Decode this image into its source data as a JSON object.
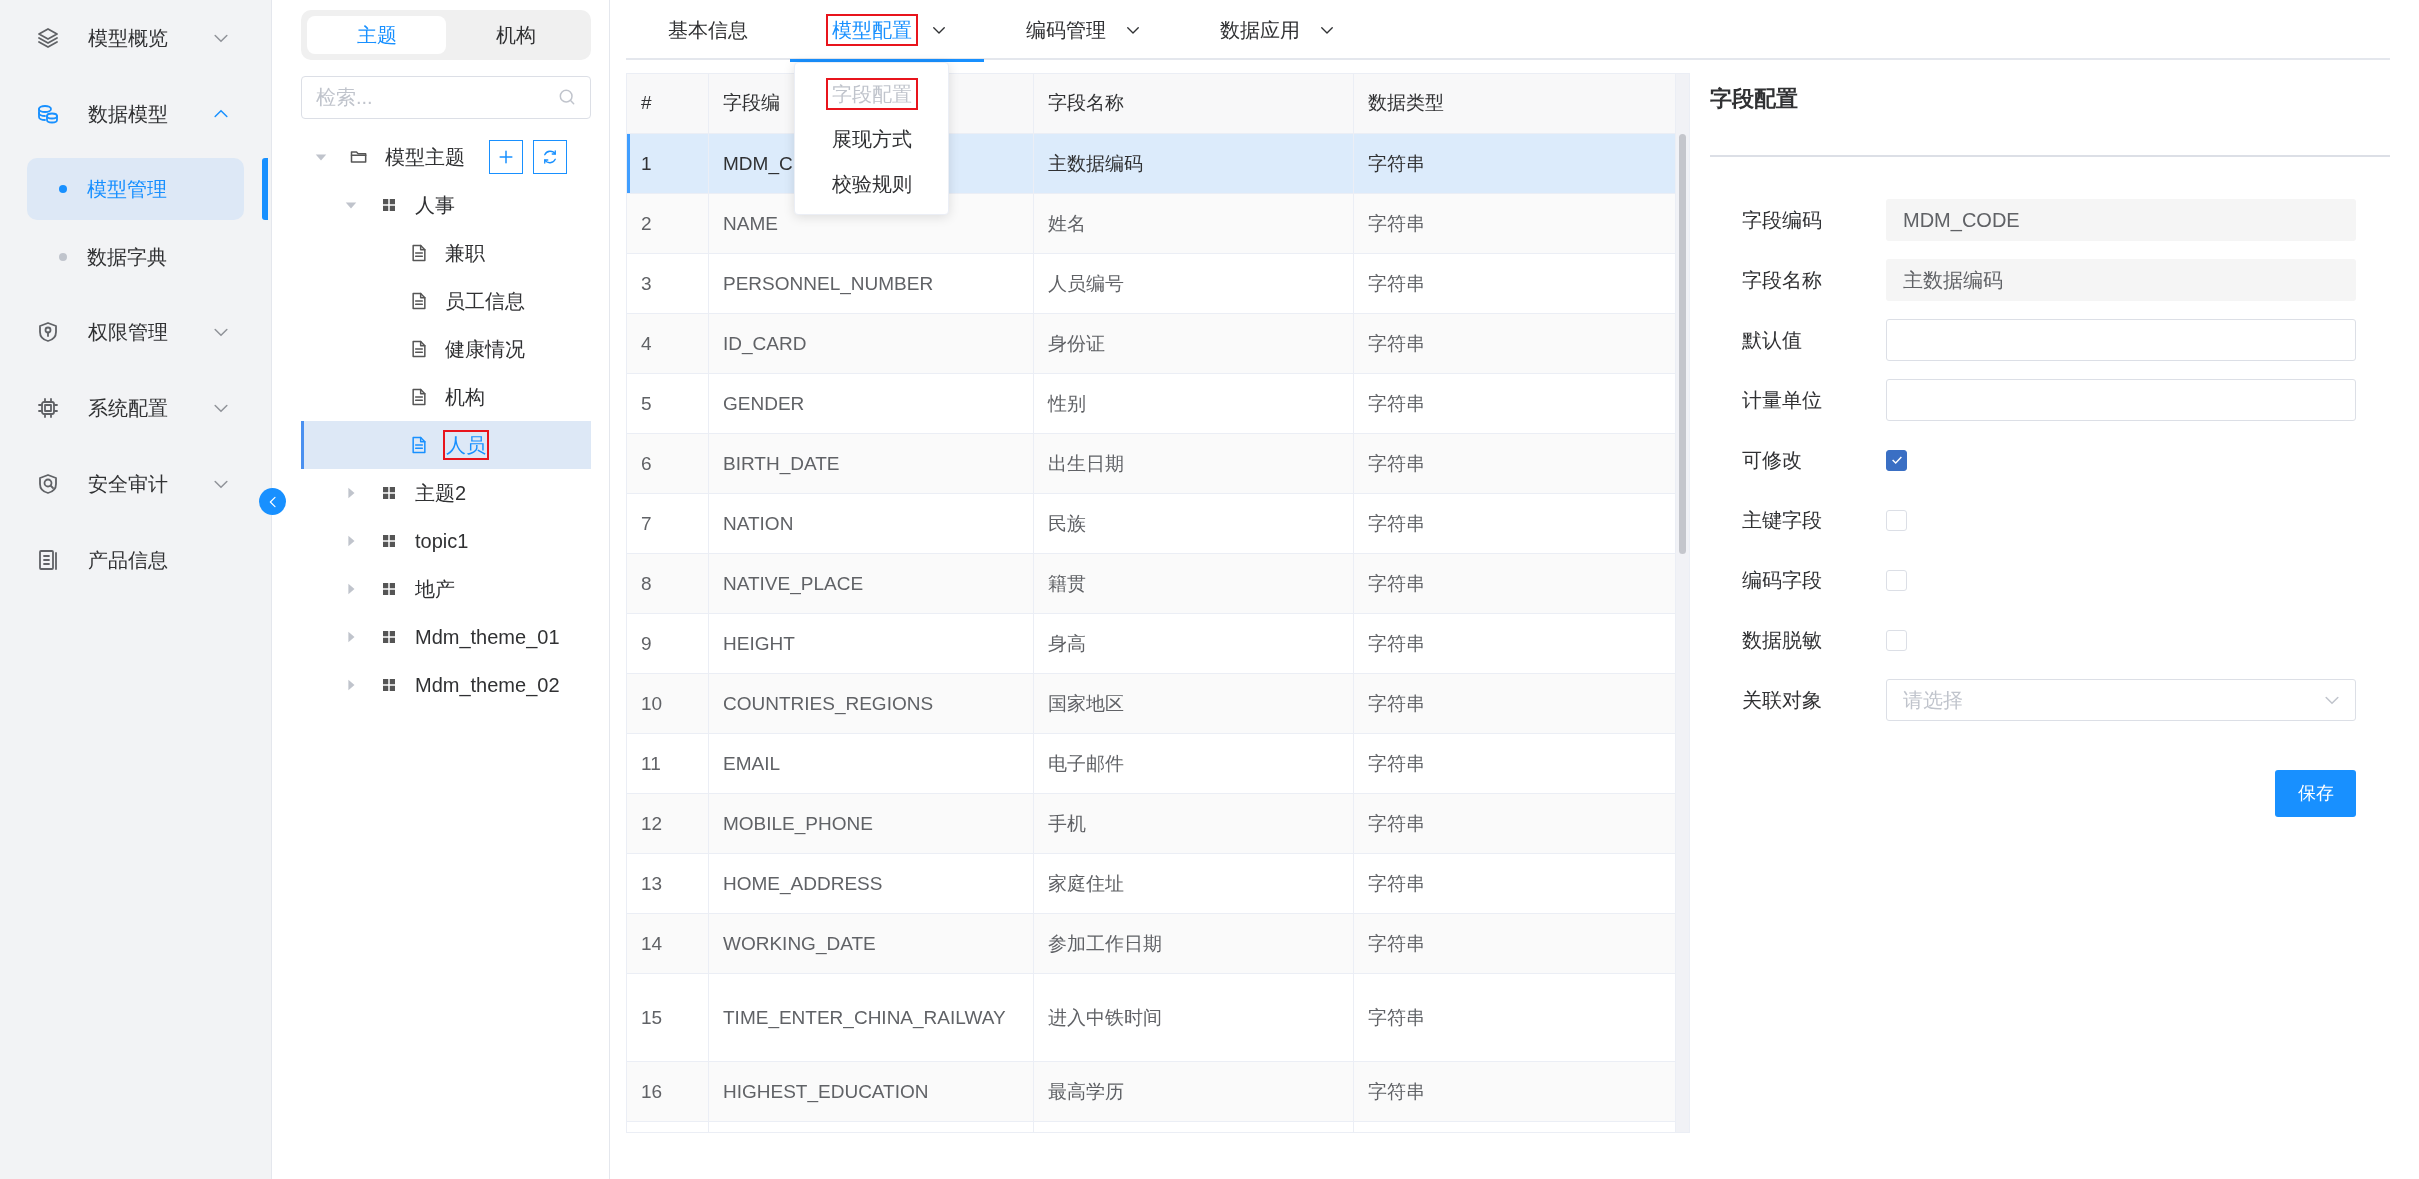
{
  "sidebar": {
    "items": [
      {
        "label": "模型概览",
        "kind": "group",
        "expanded": false
      },
      {
        "label": "数据模型",
        "kind": "group",
        "expanded": true,
        "children": [
          {
            "label": "模型管理",
            "selected": true
          },
          {
            "label": "数据字典",
            "selected": false
          }
        ]
      },
      {
        "label": "权限管理",
        "kind": "group",
        "expanded": false
      },
      {
        "label": "系统配置",
        "kind": "group",
        "expanded": false
      },
      {
        "label": "安全审计",
        "kind": "group",
        "expanded": false
      },
      {
        "label": "产品信息",
        "kind": "link"
      }
    ]
  },
  "tree_panel": {
    "tabs": [
      {
        "label": "主题",
        "selected": true
      },
      {
        "label": "机构",
        "selected": false
      }
    ],
    "search": {
      "placeholder": "检索..."
    },
    "tree": [
      {
        "label": "模型主题",
        "kind": "folder",
        "expanded": true,
        "selected": false,
        "marked": false,
        "children": [
          {
            "label": "人事",
            "kind": "group",
            "expanded": true,
            "selected": false,
            "marked": false,
            "children": [
              {
                "label": "兼职",
                "kind": "doc",
                "selected": false,
                "marked": false
              },
              {
                "label": "员工信息",
                "kind": "doc",
                "selected": false,
                "marked": false
              },
              {
                "label": "健康情况",
                "kind": "doc",
                "selected": false,
                "marked": false
              },
              {
                "label": "机构",
                "kind": "doc",
                "selected": false,
                "marked": false
              },
              {
                "label": "人员",
                "kind": "doc",
                "selected": true,
                "marked": true
              }
            ]
          },
          {
            "label": "主题2",
            "kind": "group",
            "expanded": false,
            "selected": false,
            "marked": false
          },
          {
            "label": "topic1",
            "kind": "group",
            "expanded": false,
            "selected": false,
            "marked": false
          },
          {
            "label": "地产",
            "kind": "group",
            "expanded": false,
            "selected": false,
            "marked": false
          },
          {
            "label": "Mdm_theme_01",
            "kind": "group",
            "expanded": false,
            "selected": false,
            "marked": false
          },
          {
            "label": "Mdm_theme_02",
            "kind": "group",
            "expanded": false,
            "selected": false,
            "marked": false
          }
        ]
      }
    ]
  },
  "main_tabs": [
    {
      "label": "基本信息",
      "selected": false,
      "dropdown": false,
      "marked": false
    },
    {
      "label": "模型配置",
      "selected": true,
      "dropdown": true,
      "marked": true
    },
    {
      "label": "编码管理",
      "selected": false,
      "dropdown": true,
      "marked": false
    },
    {
      "label": "数据应用",
      "selected": false,
      "dropdown": true,
      "marked": false
    }
  ],
  "tab_menu": {
    "items": [
      {
        "label": "字段配置",
        "disabled": true,
        "marked": true
      },
      {
        "label": "展现方式",
        "disabled": false,
        "marked": false
      },
      {
        "label": "校验规则",
        "disabled": false,
        "marked": false
      }
    ]
  },
  "table": {
    "columns": [
      "#",
      "字段编",
      "字段名称",
      "数据类型"
    ],
    "rows": [
      {
        "cells": [
          "1",
          "MDM_C",
          "主数据编码",
          "字符串"
        ],
        "selected": true
      },
      {
        "cells": [
          "2",
          "NAME",
          "姓名",
          "字符串"
        ],
        "selected": false
      },
      {
        "cells": [
          "3",
          "PERSONNEL_NUMBER",
          "人员编号",
          "字符串"
        ],
        "selected": false
      },
      {
        "cells": [
          "4",
          "ID_CARD",
          "身份证",
          "字符串"
        ],
        "selected": false
      },
      {
        "cells": [
          "5",
          "GENDER",
          "性别",
          "字符串"
        ],
        "selected": false
      },
      {
        "cells": [
          "6",
          "BIRTH_DATE",
          "出生日期",
          "字符串"
        ],
        "selected": false
      },
      {
        "cells": [
          "7",
          "NATION",
          "民族",
          "字符串"
        ],
        "selected": false
      },
      {
        "cells": [
          "8",
          "NATIVE_PLACE",
          "籍贯",
          "字符串"
        ],
        "selected": false
      },
      {
        "cells": [
          "9",
          "HEIGHT",
          "身高",
          "字符串"
        ],
        "selected": false
      },
      {
        "cells": [
          "10",
          "COUNTRIES_REGIONS",
          "国家地区",
          "字符串"
        ],
        "selected": false
      },
      {
        "cells": [
          "11",
          "EMAIL",
          "电子邮件",
          "字符串"
        ],
        "selected": false
      },
      {
        "cells": [
          "12",
          "MOBILE_PHONE",
          "手机",
          "字符串"
        ],
        "selected": false
      },
      {
        "cells": [
          "13",
          "HOME_ADDRESS",
          "家庭住址",
          "字符串"
        ],
        "selected": false
      },
      {
        "cells": [
          "14",
          "WORKING_DATE",
          "参加工作日期",
          "字符串"
        ],
        "selected": false
      },
      {
        "cells": [
          "15",
          "TIME_ENTER_CHINA_RAILWAY",
          "进入中铁时间",
          "字符串"
        ],
        "selected": false
      },
      {
        "cells": [
          "16",
          "HIGHEST_EDUCATION",
          "最高学历",
          "字符串"
        ],
        "selected": false
      }
    ]
  },
  "detail_panel": {
    "title": "字段配置",
    "fields": [
      {
        "kind": "text",
        "label": "字段编码",
        "value": "MDM_CODE",
        "disabled": true
      },
      {
        "kind": "text",
        "label": "字段名称",
        "value": "主数据编码",
        "disabled": true
      },
      {
        "kind": "text",
        "label": "默认值",
        "disabled": false
      },
      {
        "kind": "text",
        "label": "计量单位",
        "disabled": false
      },
      {
        "kind": "checkbox",
        "label": "可修改",
        "checked": true
      },
      {
        "kind": "checkbox",
        "label": "主键字段",
        "checked": false
      },
      {
        "kind": "checkbox",
        "label": "编码字段",
        "checked": false
      },
      {
        "kind": "checkbox",
        "label": "数据脱敏",
        "checked": false
      },
      {
        "kind": "select",
        "label": "关联对象",
        "placeholder": "请选择"
      }
    ],
    "button": "保存"
  }
}
